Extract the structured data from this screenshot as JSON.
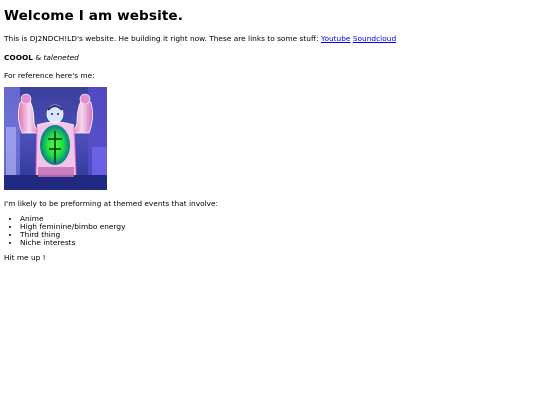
{
  "heading": "Welcome I am website.",
  "intro": {
    "text": "This is DJ2NDCH!LD's website. He building it right now. These are links to some stuff:",
    "links": [
      "Youtube",
      "Soundcloud"
    ]
  },
  "cool": {
    "bold": "COOOL",
    "amp": "&",
    "italic": "taleneted"
  },
  "reference_text": "For reference here's me:",
  "events_intro": "I'm likely to be preforming at themed events that involve:",
  "events": [
    "Anime",
    "High feminine/bimbo energy",
    "Third thing",
    "Niche interests"
  ],
  "contact": "Hit me up !",
  "colors": {
    "link": "#0000ee",
    "text": "#000000",
    "background": "#ffffff"
  }
}
